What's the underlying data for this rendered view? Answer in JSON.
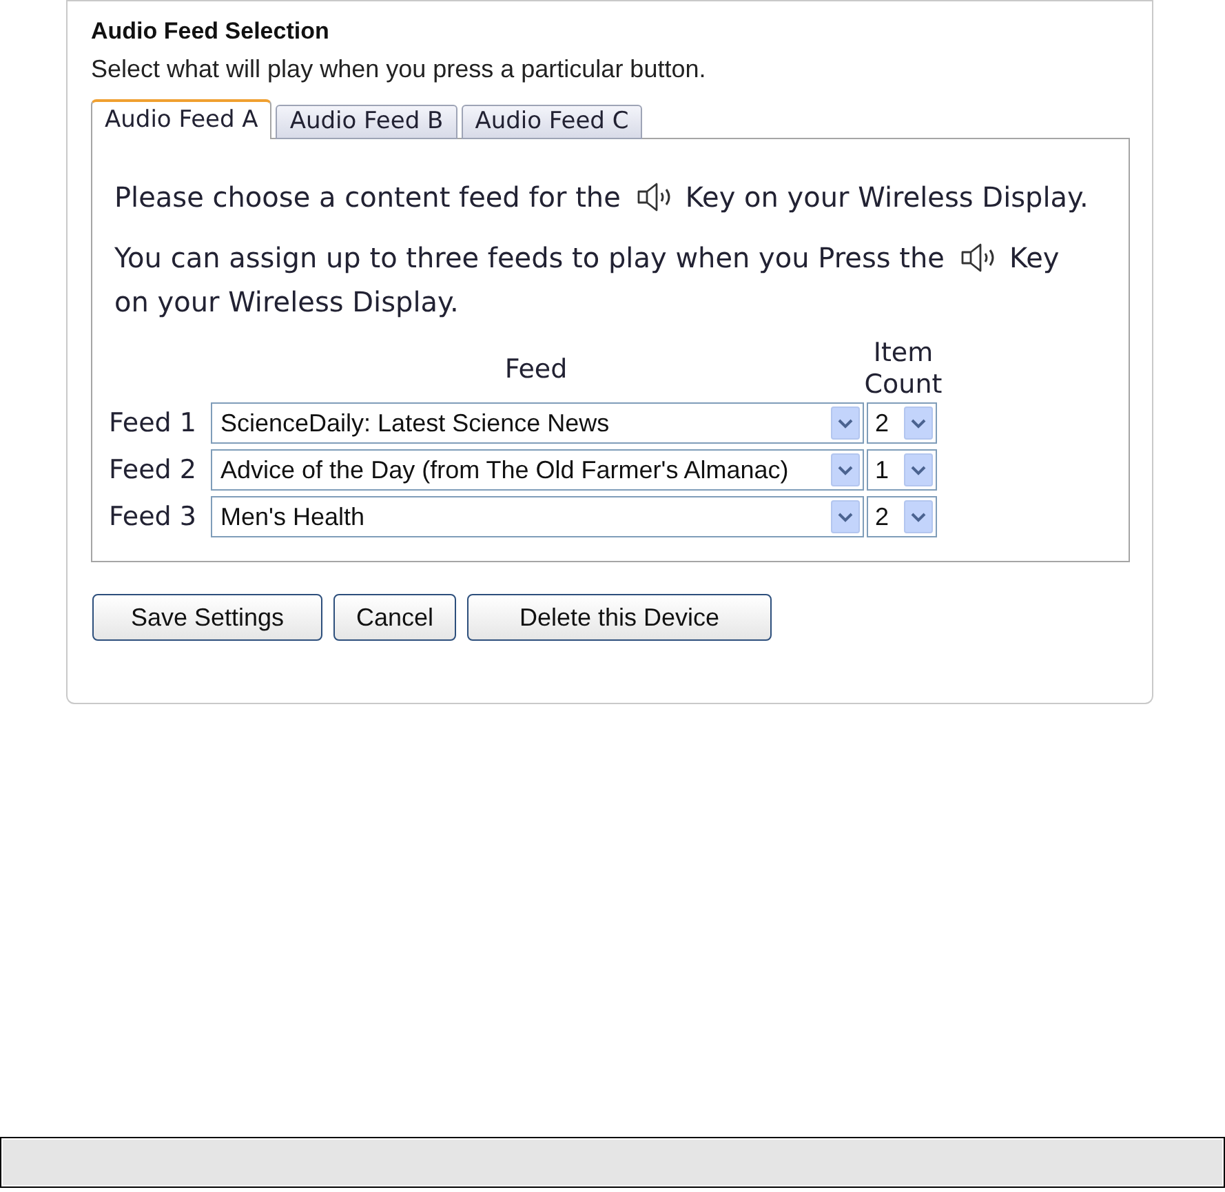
{
  "panel": {
    "title": "Audio Feed Selection",
    "subtitle": "Select what will play when you press a particular button."
  },
  "tabs": [
    {
      "label": "Audio Feed A",
      "selected": true
    },
    {
      "label": "Audio Feed B",
      "selected": false
    },
    {
      "label": "Audio Feed C",
      "selected": false
    }
  ],
  "instructions": [
    {
      "before_icon": "Please choose a content feed for the",
      "after_icon": "Key on your Wireless Display."
    },
    {
      "before_icon": "You can assign up to three feeds to play when you Press the",
      "after_icon": "Key",
      "next_line": "on your Wireless Display."
    }
  ],
  "table": {
    "columns": [
      "Feed",
      "Item Count"
    ],
    "rows": [
      {
        "label": "Feed 1",
        "feed": "ScienceDaily: Latest Science News",
        "item_count": "2"
      },
      {
        "label": "Feed 2",
        "feed": "Advice of the Day (from The Old Farmer's Almanac)",
        "item_count": "1"
      },
      {
        "label": "Feed 3",
        "feed": "Men's Health",
        "item_count": "2"
      }
    ]
  },
  "buttons": [
    "Save Settings",
    "Cancel",
    "Delete this Device"
  ]
}
